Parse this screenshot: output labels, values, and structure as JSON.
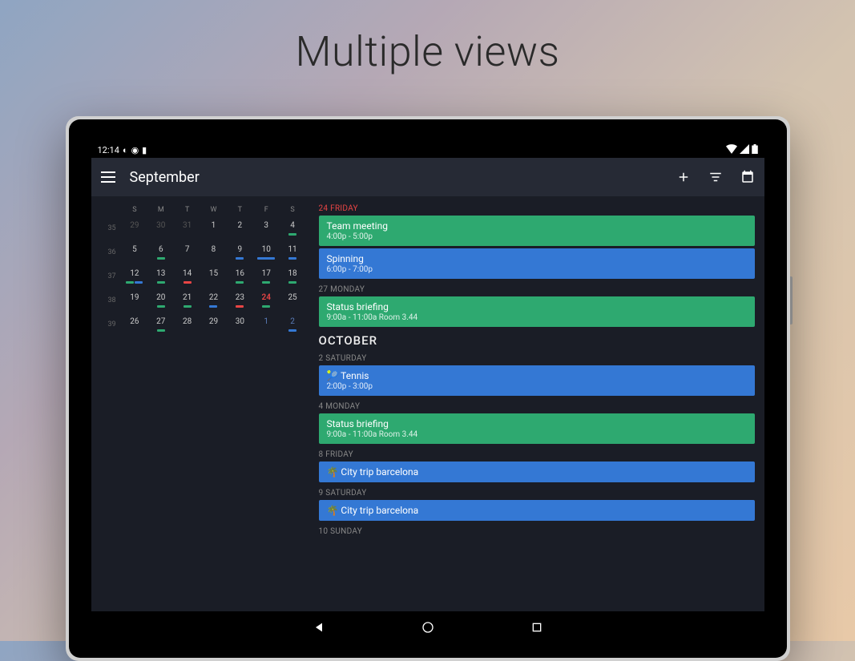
{
  "hero": {
    "title": "Multiple views"
  },
  "status": {
    "time": "12:14"
  },
  "appbar": {
    "title": "September"
  },
  "calendar": {
    "days_header": [
      "S",
      "M",
      "T",
      "W",
      "T",
      "F",
      "S"
    ],
    "weeks": [
      {
        "num": "35",
        "days": [
          {
            "n": "29",
            "muted": true
          },
          {
            "n": "30",
            "muted": true
          },
          {
            "n": "31",
            "muted": true
          },
          {
            "n": "1"
          },
          {
            "n": "2"
          },
          {
            "n": "3"
          },
          {
            "n": "4"
          }
        ]
      },
      {
        "num": "36",
        "days": [
          {
            "n": "5"
          },
          {
            "n": "6"
          },
          {
            "n": "7"
          },
          {
            "n": "8"
          },
          {
            "n": "9"
          },
          {
            "n": "10"
          },
          {
            "n": "11"
          }
        ]
      },
      {
        "num": "37",
        "days": [
          {
            "n": "12"
          },
          {
            "n": "13"
          },
          {
            "n": "14"
          },
          {
            "n": "15"
          },
          {
            "n": "16"
          },
          {
            "n": "17"
          },
          {
            "n": "18"
          }
        ]
      },
      {
        "num": "38",
        "days": [
          {
            "n": "19"
          },
          {
            "n": "20"
          },
          {
            "n": "21"
          },
          {
            "n": "22"
          },
          {
            "n": "23"
          },
          {
            "n": "24",
            "hl": true
          },
          {
            "n": "25"
          }
        ]
      },
      {
        "num": "39",
        "days": [
          {
            "n": "26"
          },
          {
            "n": "27"
          },
          {
            "n": "28"
          },
          {
            "n": "29"
          },
          {
            "n": "30"
          },
          {
            "n": "1",
            "next": true
          },
          {
            "n": "2",
            "next": true
          }
        ]
      }
    ]
  },
  "agenda": {
    "sections": [
      {
        "label": "24 FRIDAY",
        "label_red": true,
        "events": [
          {
            "title": "Team meeting",
            "sub": "4:00p - 5:00p",
            "color": "green"
          },
          {
            "title": "Spinning",
            "sub": "6:00p - 7:00p",
            "color": "blue"
          }
        ]
      },
      {
        "label": "27 MONDAY",
        "events": [
          {
            "title": "Status briefing",
            "sub": "9:00a - 11:00a Room 3.44",
            "color": "green"
          }
        ]
      },
      {
        "month": "OCTOBER"
      },
      {
        "label": "2 SATURDAY",
        "events": [
          {
            "title": "🎾 Tennis",
            "sub": "2:00p - 3:00p",
            "color": "blue"
          }
        ]
      },
      {
        "label": "4 MONDAY",
        "events": [
          {
            "title": "Status briefing",
            "sub": "9:00a - 11:00a Room 3.44",
            "color": "green"
          }
        ]
      },
      {
        "label": "8 FRIDAY",
        "events": [
          {
            "title": "🌴 City trip barcelona",
            "sub": "",
            "color": "blue"
          }
        ]
      },
      {
        "label": "9 SATURDAY",
        "events": [
          {
            "title": "🌴 City trip barcelona",
            "sub": "",
            "color": "blue"
          }
        ]
      },
      {
        "label": "10 SUNDAY",
        "events": []
      }
    ]
  }
}
